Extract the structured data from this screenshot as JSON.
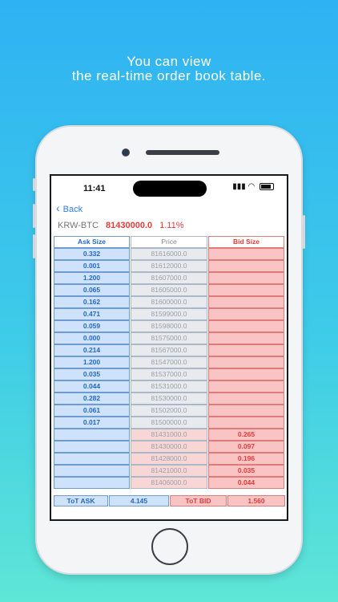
{
  "headline": {
    "line1": "You can view",
    "line2": "the real-time order book table."
  },
  "status_bar": {
    "time": "11:41"
  },
  "nav": {
    "back_label": "Back"
  },
  "ticker": {
    "symbol": "KRW-BTC",
    "price": "81430000.0",
    "change": "1.11%"
  },
  "table": {
    "headers": {
      "ask": "Ask Size",
      "price": "Price",
      "bid": "Bid Size"
    },
    "ask_rows": [
      {
        "ask": "0.332",
        "price": "81616000.0"
      },
      {
        "ask": "0.001",
        "price": "81612000.0"
      },
      {
        "ask": "1.200",
        "price": "81607000.0"
      },
      {
        "ask": "0.065",
        "price": "81605000.0"
      },
      {
        "ask": "0.162",
        "price": "81600000.0"
      },
      {
        "ask": "0.471",
        "price": "81599000.0"
      },
      {
        "ask": "0.059",
        "price": "81598000.0"
      },
      {
        "ask": "0.000",
        "price": "81575000.0"
      },
      {
        "ask": "0.214",
        "price": "81567000.0"
      },
      {
        "ask": "1.200",
        "price": "81547000.0"
      },
      {
        "ask": "0.035",
        "price": "81537000.0"
      },
      {
        "ask": "0.044",
        "price": "81531000.0"
      },
      {
        "ask": "0.282",
        "price": "81530000.0"
      },
      {
        "ask": "0.061",
        "price": "81502000.0"
      },
      {
        "ask": "0.017",
        "price": "81500000.0"
      }
    ],
    "bid_rows": [
      {
        "price": "81431000.0",
        "bid": "0.265"
      },
      {
        "price": "81430000.0",
        "bid": "0.097"
      },
      {
        "price": "81428000.0",
        "bid": "0.196"
      },
      {
        "price": "81421000.0",
        "bid": "0.035"
      },
      {
        "price": "81406000.0",
        "bid": "0.044"
      }
    ]
  },
  "totals": {
    "ask_label": "ToT ASK",
    "ask_value": "4.145",
    "bid_label": "ToT BID",
    "bid_value": "1.560"
  },
  "icons": {
    "back": "chevron-left-icon",
    "wifi": "wifi-icon",
    "signal": "signal-icon",
    "battery": "battery-icon"
  },
  "colors": {
    "ask": "#2468c8",
    "bid": "#e43b3b",
    "background_top": "#2fb2f3",
    "background_bottom": "#5ee6d6"
  }
}
